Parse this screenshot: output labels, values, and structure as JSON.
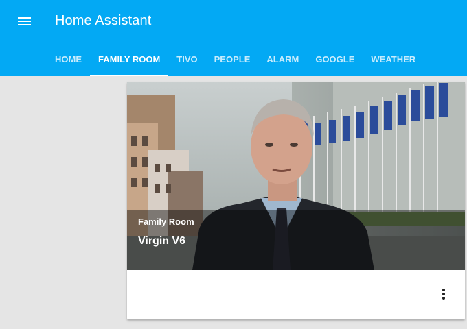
{
  "header": {
    "title": "Home Assistant",
    "menu_icon": "menu-icon"
  },
  "tabs": [
    {
      "label": "Home",
      "active": false
    },
    {
      "label": "Family Room",
      "active": true
    },
    {
      "label": "TiVo",
      "active": false
    },
    {
      "label": "People",
      "active": false
    },
    {
      "label": "Alarm",
      "active": false
    },
    {
      "label": "Google",
      "active": false
    },
    {
      "label": "Weather",
      "active": false
    }
  ],
  "media_card": {
    "subtitle": "Family Room",
    "title": "Virgin V6",
    "menu_icon": "more-vert-icon"
  },
  "colors": {
    "primary": "#03a9f4",
    "background": "#e5e5e5"
  }
}
